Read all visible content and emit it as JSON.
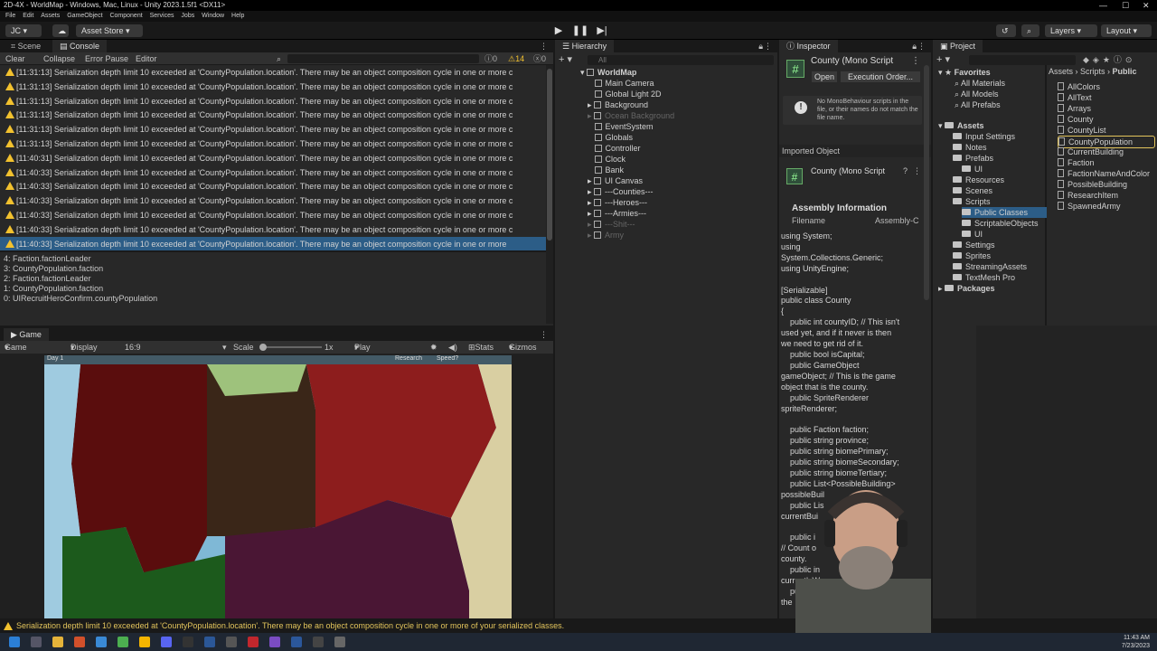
{
  "window": {
    "title": "2D-4X - WorldMap - Windows, Mac, Linux - Unity 2023.1.5f1 <DX11>",
    "controls": [
      "—",
      "☐",
      "✕"
    ]
  },
  "menu": [
    "File",
    "Edit",
    "Assets",
    "GameObject",
    "Component",
    "Services",
    "Jobs",
    "Window",
    "Help"
  ],
  "toolbar": {
    "account": "JC",
    "asset_store": "Asset Store",
    "layers": "Layers",
    "layout": "Layout"
  },
  "console": {
    "tabs": [
      "Scene",
      "Console"
    ],
    "buttons": {
      "clear": "Clear",
      "collapse": "Collapse",
      "error_pause": "Error Pause",
      "editor": "Editor"
    },
    "counts": {
      "info": "0",
      "warn": "14",
      "error": "0"
    },
    "logs": [
      "[11:31:13] Serialization depth limit 10 exceeded at 'CountyPopulation.location'. There may be an object composition cycle in one or more c",
      "[11:31:13] Serialization depth limit 10 exceeded at 'CountyPopulation.location'. There may be an object composition cycle in one or more c",
      "[11:31:13] Serialization depth limit 10 exceeded at 'CountyPopulation.location'. There may be an object composition cycle in one or more c",
      "[11:31:13] Serialization depth limit 10 exceeded at 'CountyPopulation.location'. There may be an object composition cycle in one or more c",
      "[11:31:13] Serialization depth limit 10 exceeded at 'CountyPopulation.location'. There may be an object composition cycle in one or more c",
      "[11:31:13] Serialization depth limit 10 exceeded at 'CountyPopulation.location'. There may be an object composition cycle in one or more c",
      "[11:40:31] Serialization depth limit 10 exceeded at 'CountyPopulation.location'. There may be an object composition cycle in one or more c",
      "[11:40:33] Serialization depth limit 10 exceeded at 'CountyPopulation.location'. There may be an object composition cycle in one or more c",
      "[11:40:33] Serialization depth limit 10 exceeded at 'CountyPopulation.location'. There may be an object composition cycle in one or more c",
      "[11:40:33] Serialization depth limit 10 exceeded at 'CountyPopulation.location'. There may be an object composition cycle in one or more c",
      "[11:40:33] Serialization depth limit 10 exceeded at 'CountyPopulation.location'. There may be an object composition cycle in one or more c",
      "[11:40:33] Serialization depth limit 10 exceeded at 'CountyPopulation.location'. There may be an object composition cycle in one or more c",
      "[11:40:33] Serialization depth limit 10 exceeded at 'CountyPopulation.location'. There may be an object composition cycle in one or more"
    ],
    "stack": [
      "4: Faction.factionLeader",
      "3: CountyPopulation.faction",
      "2: Faction.factionLeader",
      "1: CountyPopulation.faction",
      "0: UIRecruitHeroConfirm.countyPopulation"
    ]
  },
  "game": {
    "tab": "Game",
    "display_mode": "Game",
    "display": "Display 1",
    "aspect": "16:9 Aspect",
    "scale_label": "Scale",
    "scale_value": "1x",
    "play_focused": "Play Focused",
    "stats": "Stats",
    "gizmos": "Gizmos",
    "hud_day": "Day 1",
    "hud_research": "Research",
    "hud_speed": "Speed?"
  },
  "hierarchy": {
    "tab": "Hierarchy",
    "search_placeholder": "All",
    "root": "WorldMap",
    "items": [
      "Main Camera",
      "Global Light 2D",
      "Background",
      "Ocean Background",
      "EventSystem",
      "Globals",
      "Controller",
      "Clock",
      "Bank",
      "UI Canvas",
      "---Counties---",
      "---Heroes---",
      "---Armies---",
      "---Shit---",
      "Army"
    ]
  },
  "inspector": {
    "tab": "Inspector",
    "title": "County (Mono Script",
    "open": "Open",
    "execution_order": "Execution Order...",
    "notice": "No MonoBehaviour scripts in the file, or their names do not match the file name.",
    "imported": "Imported Object",
    "imported_title": "County (Mono Script",
    "assembly": "Assembly Information",
    "filename_label": "Filename",
    "filename_value": "Assembly-C",
    "code": "using System;\nusing\nSystem.Collections.Generic;\nusing UnityEngine;\n\n[Serializable]\npublic class County\n{\n    public int countyID; // This isn't\nused yet, and if it never is then\nwe need to get rid of it.\n    public bool isCapital;\n    public GameObject\ngameObject; // This is the game\nobject that is the county.\n    public SpriteRenderer\nspriteRenderer;\n\n    public Faction faction;\n    public string province;\n    public string biomePrimary;\n    public string biomeSecondary;\n    public string biomeTertiary;\n    public List<PossibleBuilding>\npossibleBuil\n    public Lis\ncurrentBui\n\n    public i\n// Count o\ncounty.\n    public in\ncurrentlyWo\n    public\nthe"
  },
  "project": {
    "tab": "Project",
    "favorites": "Favorites",
    "fav_items": [
      "All Materials",
      "All Models",
      "All Prefabs"
    ],
    "assets": "Assets",
    "tree": [
      "Input Settings",
      "Notes",
      "Prefabs",
      "UI",
      "Resources",
      "Scenes",
      "Scripts",
      "Public Classes",
      "ScriptableObjects",
      "UI",
      "Settings",
      "Sprites",
      "StreamingAssets",
      "TextMesh Pro"
    ],
    "packages": "Packages",
    "breadcrumb": [
      "Assets",
      "Scripts",
      "Public"
    ],
    "files": [
      "AllColors",
      "AllText",
      "Arrays",
      "County",
      "CountyList",
      "CountyPopulation",
      "CurrentBuilding",
      "Faction",
      "FactionNameAndColor",
      "PossibleBuilding",
      "ResearchItem",
      "SpawnedArmy"
    ]
  },
  "status": "Serialization depth limit 10 exceeded at 'CountyPopulation.location'. There may be an object composition cycle in one or more of your serialized classes.",
  "clock": {
    "time": "11:43 AM",
    "date": "7/23/2023"
  }
}
